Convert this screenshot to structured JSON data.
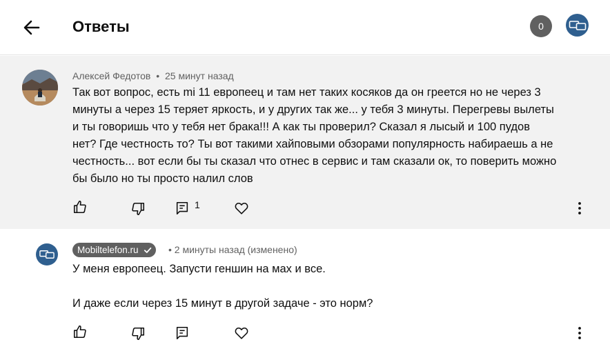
{
  "header": {
    "title": "Ответы",
    "count_badge": "0",
    "back_icon": "arrow-left-icon",
    "channel_icon": "channel-avatar-icon"
  },
  "main_comment": {
    "author": "Алексей Федотов",
    "separator": "•",
    "time": "25 минут назад",
    "lines": [
      "Так вот вопрос, есть mi 11 европеец и там нет таких косяков да он греется но не через 3",
      "минуты а через 15 теряет яркость,  и у других так же... у тебя 3  минуты. Перегревы вылеты",
      "и ты говоришь что у тебя нет брака!!! А как ты проверил? Сказал я лысый и 100 пудов",
      "нет? Где честность то? Ты вот такими хайповыми обзорами популярность набираешь а не",
      "честность... вот если бы ты сказал что отнес в сервис и там сказали ок, то поверить можно",
      "бы было но ты просто налил слов"
    ],
    "reply_count": "1",
    "background": "#f2f2f2"
  },
  "reply_comment": {
    "author": "Mobiltelefon.ru",
    "separator": "•",
    "time": "2 минуты назад (изменено)",
    "line1": "У меня европеец. Запусти геншин на мах и все.",
    "line2": "И даже если через 15 минут в другой задаче - это норм?"
  },
  "colors": {
    "accent_channel": "#2f5f8f",
    "badge": "#606060",
    "meta_text": "#606060"
  }
}
